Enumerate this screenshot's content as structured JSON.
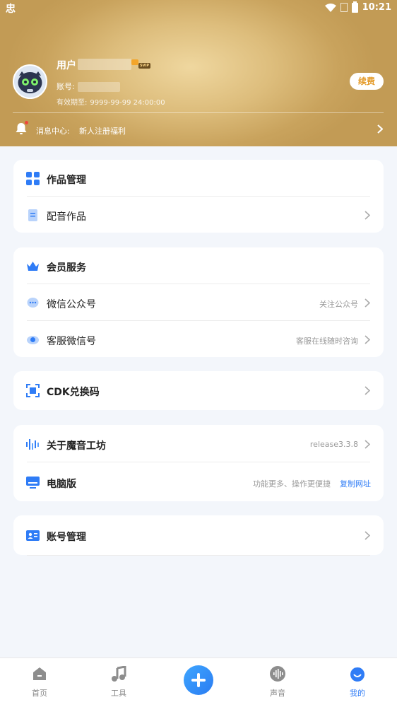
{
  "status_bar": {
    "app_icon": "忠",
    "time": "10:21"
  },
  "profile": {
    "user_label": "用户",
    "svip_badge": "SVIP",
    "account_label": "账号:",
    "expiry_label": "有效期至:",
    "expiry_value": "9999-99-99 24:00:00",
    "renew_label": "续费"
  },
  "messages": {
    "label": "消息中心:",
    "text": "新人注册福利"
  },
  "works": {
    "title": "作品管理",
    "items": [
      {
        "label": "配音作品"
      }
    ]
  },
  "member": {
    "title": "会员服务",
    "items": [
      {
        "label": "微信公众号",
        "right": "关注公众号"
      },
      {
        "label": "客服微信号",
        "right": "客服在线随时咨询"
      }
    ]
  },
  "cdk": {
    "label": "CDK兑换码"
  },
  "about": {
    "label": "关于魔音工坊",
    "version": "release3.3.8",
    "pc_label": "电脑版",
    "pc_desc": "功能更多、操作更便捷",
    "pc_link": "复制网址"
  },
  "account_mgmt": {
    "label": "账号管理"
  },
  "tabs": [
    {
      "label": "首页",
      "icon": "home-icon"
    },
    {
      "label": "工具",
      "icon": "music-note-icon"
    },
    {
      "label": "",
      "icon": "plus-icon"
    },
    {
      "label": "声音",
      "icon": "soundwave-icon"
    },
    {
      "label": "我的",
      "icon": "profile-face-icon"
    }
  ],
  "colors": {
    "accent": "#2f7cf6",
    "gold": "#d7b26c",
    "renew_text": "#e49b2a"
  }
}
